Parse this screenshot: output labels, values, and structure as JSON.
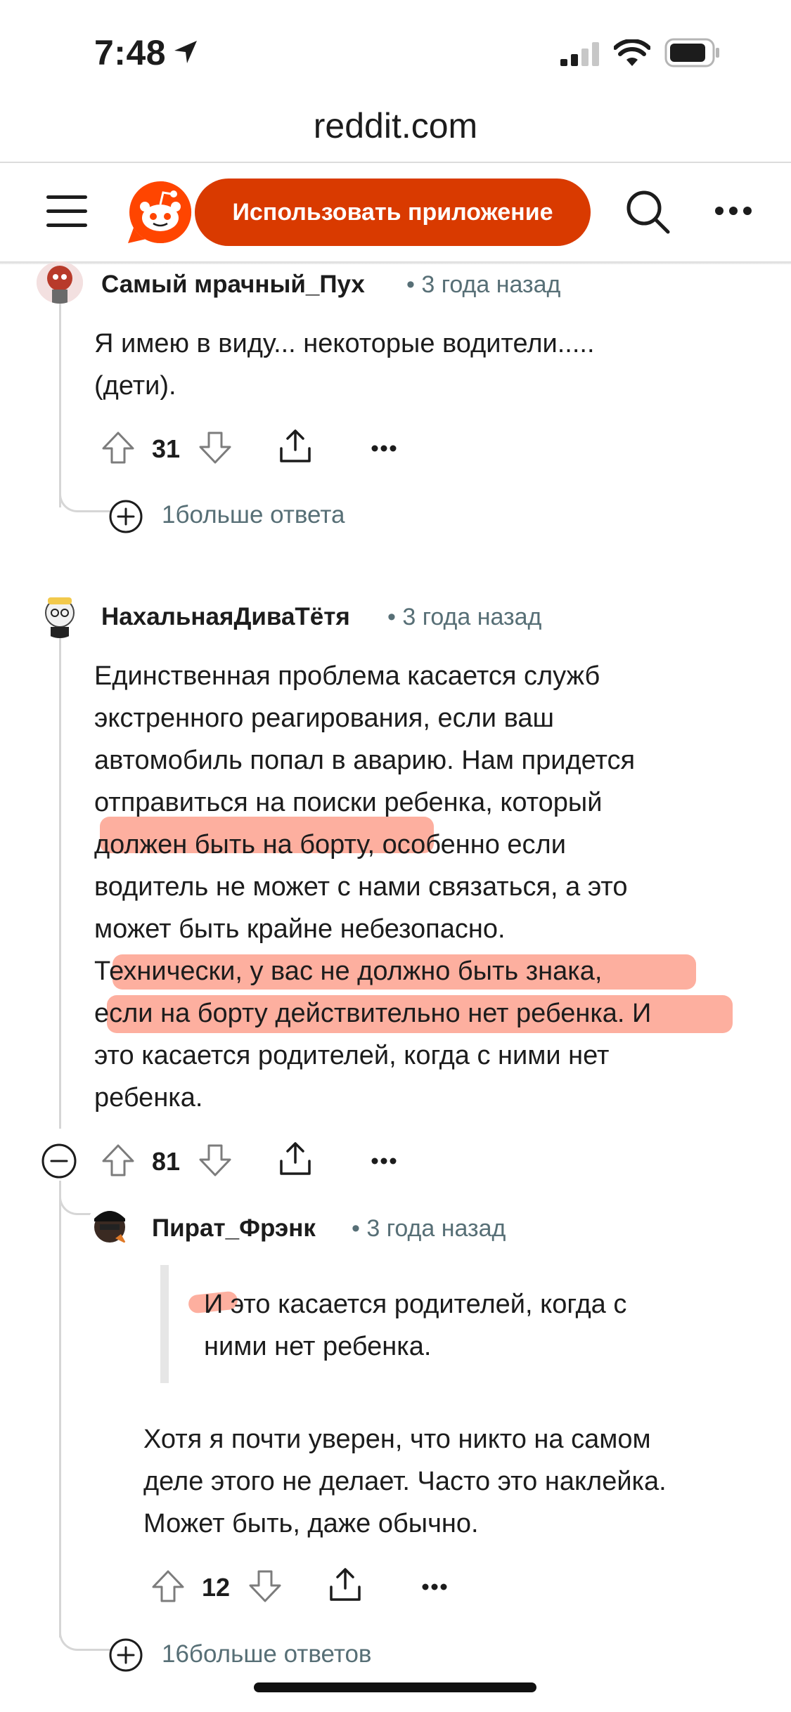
{
  "status_bar": {
    "time": "7:48"
  },
  "browser": {
    "url": "reddit.com"
  },
  "header": {
    "app_button_label": "Использовать приложение",
    "brand_color": "#d93a00"
  },
  "comments": [
    {
      "author": "Самый мрачный_Пух",
      "time": "3 года назад",
      "text_lines": [
        "Я имею в виду... некоторые водители.....",
        "(дети)."
      ],
      "votes": "31",
      "more_replies": "1больше ответа"
    },
    {
      "author": "НахальнаяДиваТётя",
      "time": "3 года назад",
      "text_lines": [
        "Единственная проблема касается служб",
        "экстренного реагирования, если ваш",
        "автомобиль попал в аварию. Нам придется",
        "отправиться на поиски ребенка, который",
        "должен быть на борту, особенно если",
        "водитель не может с нами связаться, а это",
        "может быть крайне небезопасно.",
        "Технически, у вас не должно быть знака,",
        "если на борту действительно нет ребенка. И",
        "это касается родителей, когда с ними нет",
        "ребенка."
      ],
      "votes": "81"
    },
    {
      "author": "Пират_Фрэнк",
      "time": "3 года назад",
      "quote_lines": [
        "И это касается родителей, когда с",
        "ними нет ребенка."
      ],
      "text_lines": [
        "Хотя я почти уверен, что никто на самом",
        "деле этого не делает. Часто это наклейка.",
        "Может быть, даже обычно."
      ],
      "votes": "12",
      "more_replies": "16больше ответов"
    }
  ],
  "colors": {
    "meta": "#576f76",
    "highlight": "#fc6e50"
  }
}
